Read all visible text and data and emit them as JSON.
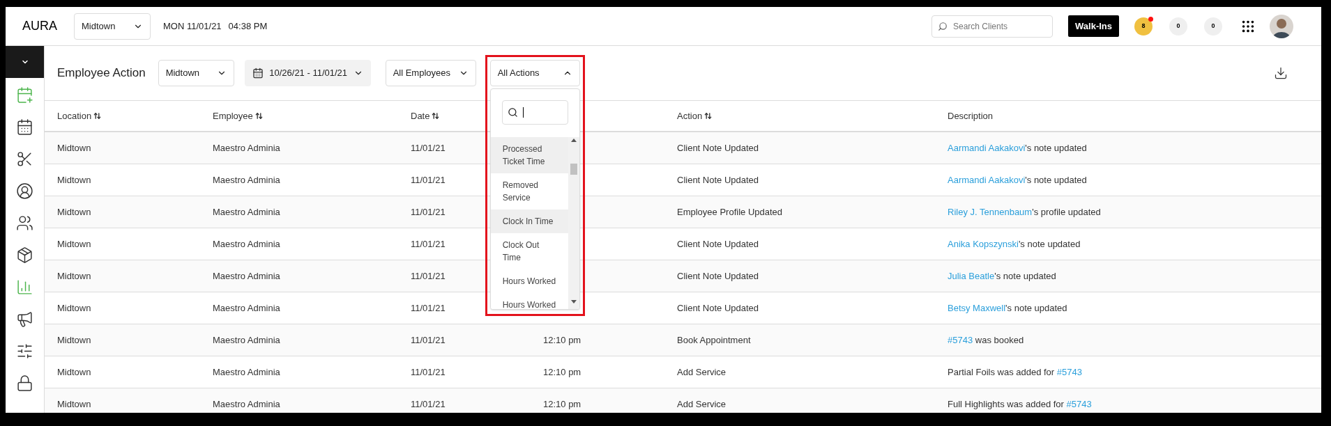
{
  "top_bar": {
    "logo": "AURA",
    "location_select": "Midtown",
    "date": "MON 11/01/21",
    "time": "04:38 PM",
    "search": {
      "placeholder": "Search Clients"
    },
    "walk_ins_button": "Walk-Ins",
    "badges": [
      {
        "count": "8",
        "color": "#f0c040",
        "alert": true
      },
      {
        "count": "0",
        "color": "#efefef",
        "alert": false
      },
      {
        "count": "0",
        "color": "#efefef",
        "alert": false
      }
    ]
  },
  "sidebar": {
    "items": [
      {
        "active": true
      },
      {
        "active": false
      },
      {
        "active": false
      },
      {
        "active": false
      },
      {
        "active": false
      },
      {
        "active": false
      },
      {
        "active": true
      },
      {
        "active": false
      },
      {
        "active": false
      },
      {
        "active": false
      }
    ]
  },
  "page": {
    "title": "Employee Action",
    "location_filter": "Midtown",
    "date_range": "10/26/21 - 11/01/21",
    "employee_filter": "All Employees",
    "action_filter": {
      "value": "All Actions",
      "expanded": true,
      "items": [
        {
          "label": "Processed Ticket Time",
          "selected": true
        },
        {
          "label": "Removed Service",
          "selected": false
        },
        {
          "label": "Clock In Time",
          "selected": true
        },
        {
          "label": "Clock Out Time",
          "selected": false
        },
        {
          "label": "Hours Worked",
          "selected": false
        },
        {
          "label": "Hours Worked",
          "selected": false
        }
      ]
    }
  },
  "table": {
    "columns": [
      {
        "label": "Location",
        "sortable": true
      },
      {
        "label": "Employee",
        "sortable": true
      },
      {
        "label": "Date",
        "sortable": true
      },
      {
        "label": "Action",
        "sortable": true
      },
      {
        "label": "Description",
        "sortable": false
      }
    ],
    "rows": [
      {
        "location": "Midtown",
        "employee": "Maestro Adminia",
        "date": "11/01/21",
        "action": "Client Note Updated",
        "description": {
          "link": "Aarmandi Aakakovi",
          "after": "'s note updated"
        }
      },
      {
        "location": "Midtown",
        "employee": "Maestro Adminia",
        "date": "11/01/21",
        "action": "Client Note Updated",
        "description": {
          "link": "Aarmandi Aakakovi",
          "after": "'s note updated"
        }
      },
      {
        "location": "Midtown",
        "employee": "Maestro Adminia",
        "date": "11/01/21",
        "action": "Employee Profile Updated",
        "description": {
          "link": "Riley J. Tennenbaum",
          "after": "'s profile updated"
        }
      },
      {
        "location": "Midtown",
        "employee": "Maestro Adminia",
        "date": "11/01/21",
        "action": "Client Note Updated",
        "description": {
          "link": "Anika Kopszynski",
          "after": "'s note updated"
        }
      },
      {
        "location": "Midtown",
        "employee": "Maestro Adminia",
        "date": "11/01/21",
        "action": "Client Note Updated",
        "description": {
          "link": "Julia Beatle",
          "after": "'s note updated"
        }
      },
      {
        "location": "Midtown",
        "employee": "Maestro Adminia",
        "date": "11/01/21",
        "action": "Client Note Updated",
        "description": {
          "link": "Betsy Maxwell",
          "after": "'s note updated"
        }
      },
      {
        "location": "Midtown",
        "employee": "Maestro Adminia",
        "date": "11/01/21",
        "time": "12:10 pm",
        "action": "Book Appointment",
        "description": {
          "link": "#5743",
          "after": " was booked"
        }
      },
      {
        "location": "Midtown",
        "employee": "Maestro Adminia",
        "date": "11/01/21",
        "time": "12:10 pm",
        "action": "Add Service",
        "description": {
          "before": "Partial Foils was added for ",
          "link": "#5743"
        }
      },
      {
        "location": "Midtown",
        "employee": "Maestro Adminia",
        "date": "11/01/21",
        "time": "12:10 pm",
        "action": "Add Service",
        "description": {
          "before": "Full Highlights was added for ",
          "link": "#5743"
        }
      }
    ]
  }
}
